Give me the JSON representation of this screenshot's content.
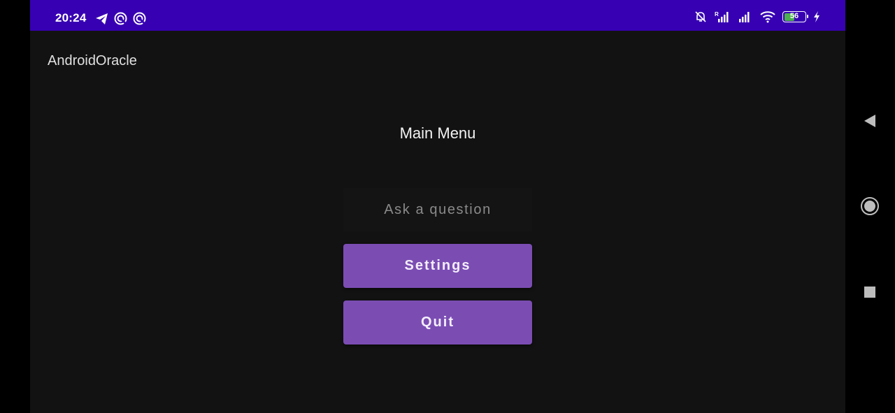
{
  "status_bar": {
    "time": "20:24",
    "left_icons": [
      "telegram-icon",
      "sync-icon",
      "sync-icon"
    ],
    "right_icons": [
      "muted-bell-icon",
      "signal-roaming-icon",
      "signal-icon",
      "wifi-icon",
      "battery-icon",
      "charging-bolt-icon"
    ],
    "roaming_label": "R",
    "battery_level": "56",
    "battery_fill_percent": 56,
    "color": "#3700b3"
  },
  "app": {
    "title": "AndroidOracle"
  },
  "main": {
    "heading": "Main Menu",
    "question_input": {
      "value": "",
      "placeholder": "Ask a question"
    },
    "buttons": {
      "settings_label": "Settings",
      "quit_label": "Quit"
    },
    "button_color": "#7b4db3"
  },
  "nav_bar": {
    "icons": [
      "back-triangle-icon",
      "home-circle-icon",
      "recents-square-icon"
    ]
  }
}
